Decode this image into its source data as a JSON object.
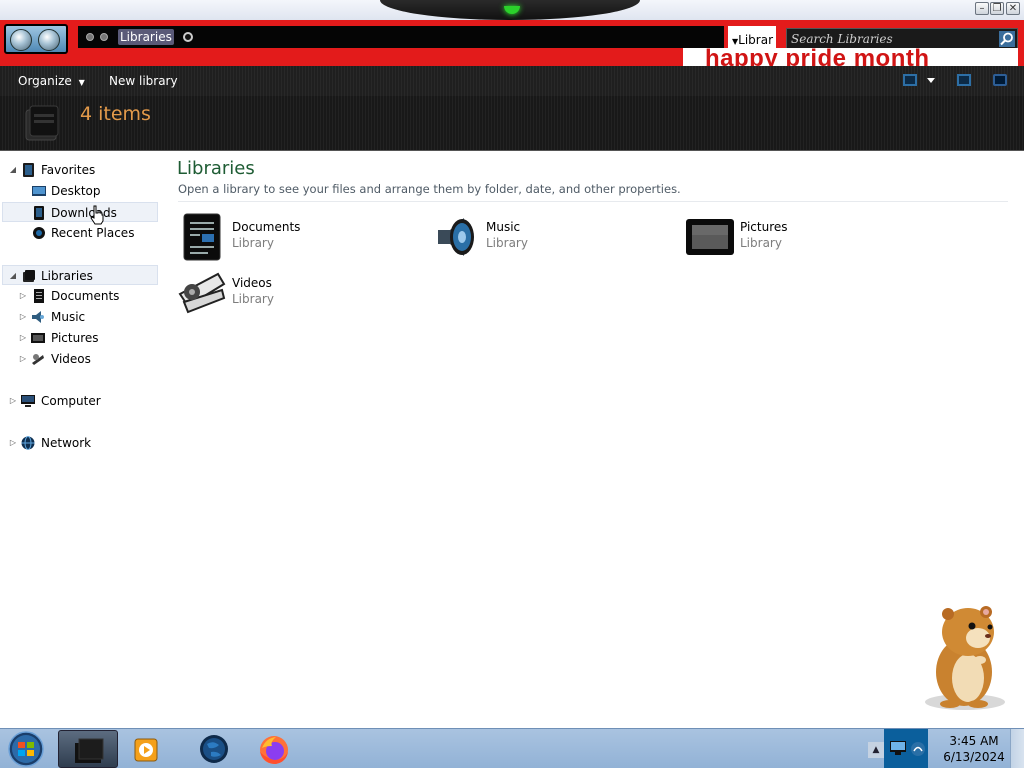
{
  "window": {
    "breadcrumb": "Libraries",
    "partial_tab_label": "Librar",
    "search_placeholder": "Search Libraries",
    "banner_text": "happy pride month",
    "controls": {
      "minimize": "–",
      "maximize": "❐",
      "close": "✕"
    }
  },
  "toolbar": {
    "organize_label": "Organize",
    "new_library_label": "New library"
  },
  "header": {
    "item_count": "4 items"
  },
  "nav": {
    "favorites": {
      "label": "Favorites",
      "items": [
        {
          "label": "Desktop",
          "icon": "desktop-icon"
        },
        {
          "label": "Downloads",
          "icon": "downloads-icon"
        },
        {
          "label": "Recent Places",
          "icon": "recent-places-icon"
        }
      ]
    },
    "libraries": {
      "label": "Libraries",
      "items": [
        {
          "label": "Documents",
          "icon": "documents-icon"
        },
        {
          "label": "Music",
          "icon": "music-icon"
        },
        {
          "label": "Pictures",
          "icon": "pictures-icon"
        },
        {
          "label": "Videos",
          "icon": "videos-icon"
        }
      ]
    },
    "computer": {
      "label": "Computer"
    },
    "network": {
      "label": "Network"
    }
  },
  "content": {
    "title": "Libraries",
    "subtitle": "Open a library to see your files and arrange them by folder, date, and other properties.",
    "libraries": [
      {
        "name": "Documents",
        "type": "Library",
        "icon": "documents-icon"
      },
      {
        "name": "Music",
        "type": "Library",
        "icon": "music-icon"
      },
      {
        "name": "Pictures",
        "type": "Library",
        "icon": "pictures-icon"
      },
      {
        "name": "Videos",
        "type": "Library",
        "icon": "videos-icon"
      }
    ]
  },
  "taskbar": {
    "time": "3:45 AM",
    "date": "6/13/2024",
    "apps": [
      "windows-explorer",
      "media-player",
      "globe-browser",
      "firefox"
    ]
  },
  "colors": {
    "title_red": "#e31b1b",
    "item_count_orange": "#e39a4a",
    "heading_green": "#1e5c34",
    "taskbar_blue": "#a9c3e0"
  }
}
